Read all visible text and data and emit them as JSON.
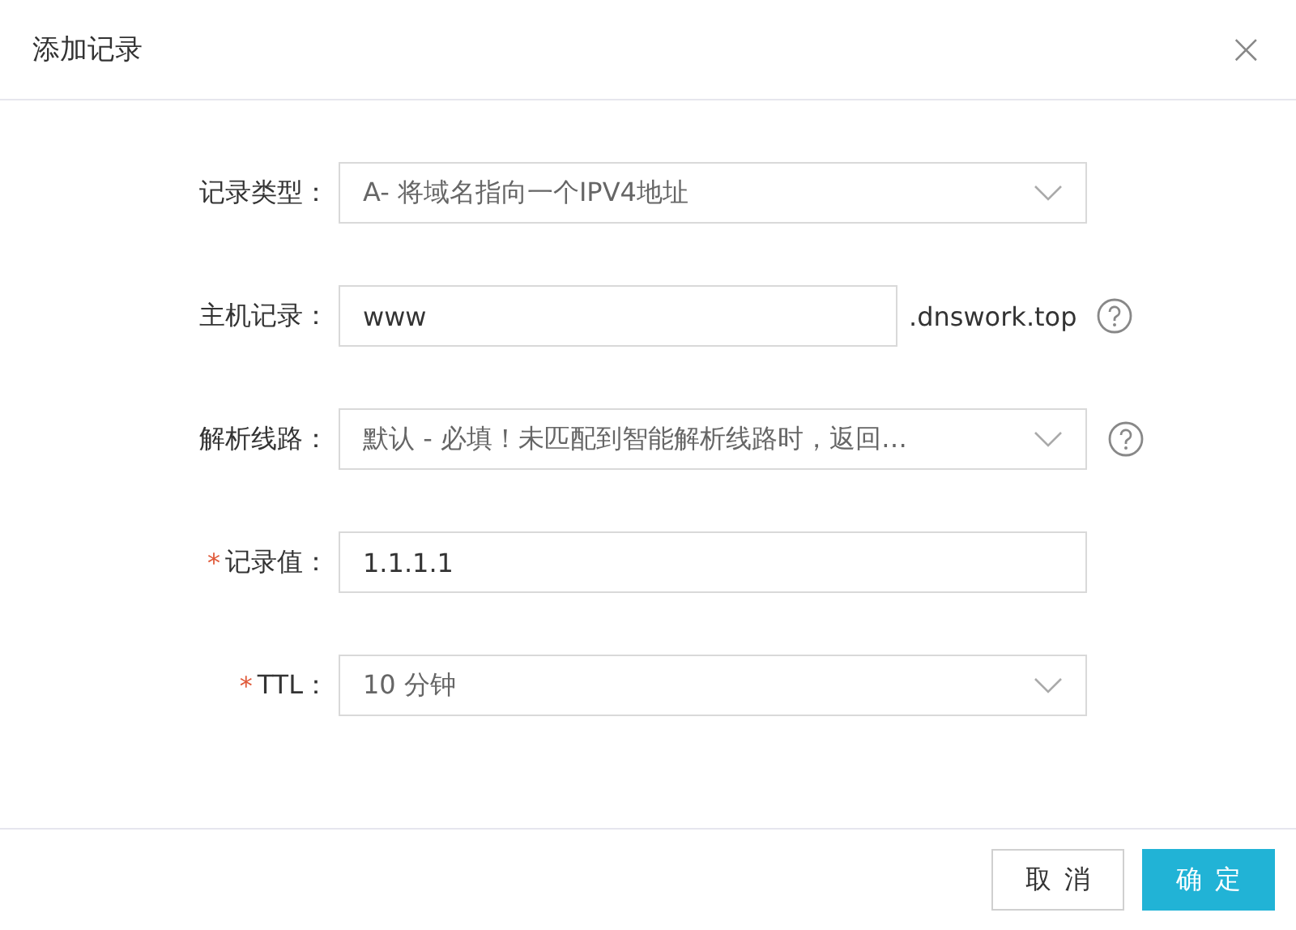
{
  "dialog": {
    "title": "添加记录",
    "close": "×"
  },
  "required_mark": "*",
  "fields": [
    {
      "label": "记录类型：",
      "kind": "select",
      "value": "A- 将域名指向一个IPV4地址",
      "required": false,
      "help": false
    },
    {
      "label": "主机记录：",
      "kind": "input",
      "value": "www",
      "suffix": ".dnswork.top",
      "required": false,
      "help": true
    },
    {
      "label": "解析线路：",
      "kind": "select",
      "value": "默认 - 必填！未匹配到智能解析线路时，返回…",
      "required": false,
      "help": true
    },
    {
      "label": "记录值：",
      "kind": "input",
      "value": "1.1.1.1",
      "required": true,
      "help": false
    },
    {
      "label": "TTL：",
      "kind": "select",
      "value": "10 分钟",
      "required": true,
      "help": false
    }
  ],
  "buttons": [
    {
      "label": "取消",
      "kind": "secondary"
    },
    {
      "label": "确定",
      "kind": "primary"
    }
  ]
}
